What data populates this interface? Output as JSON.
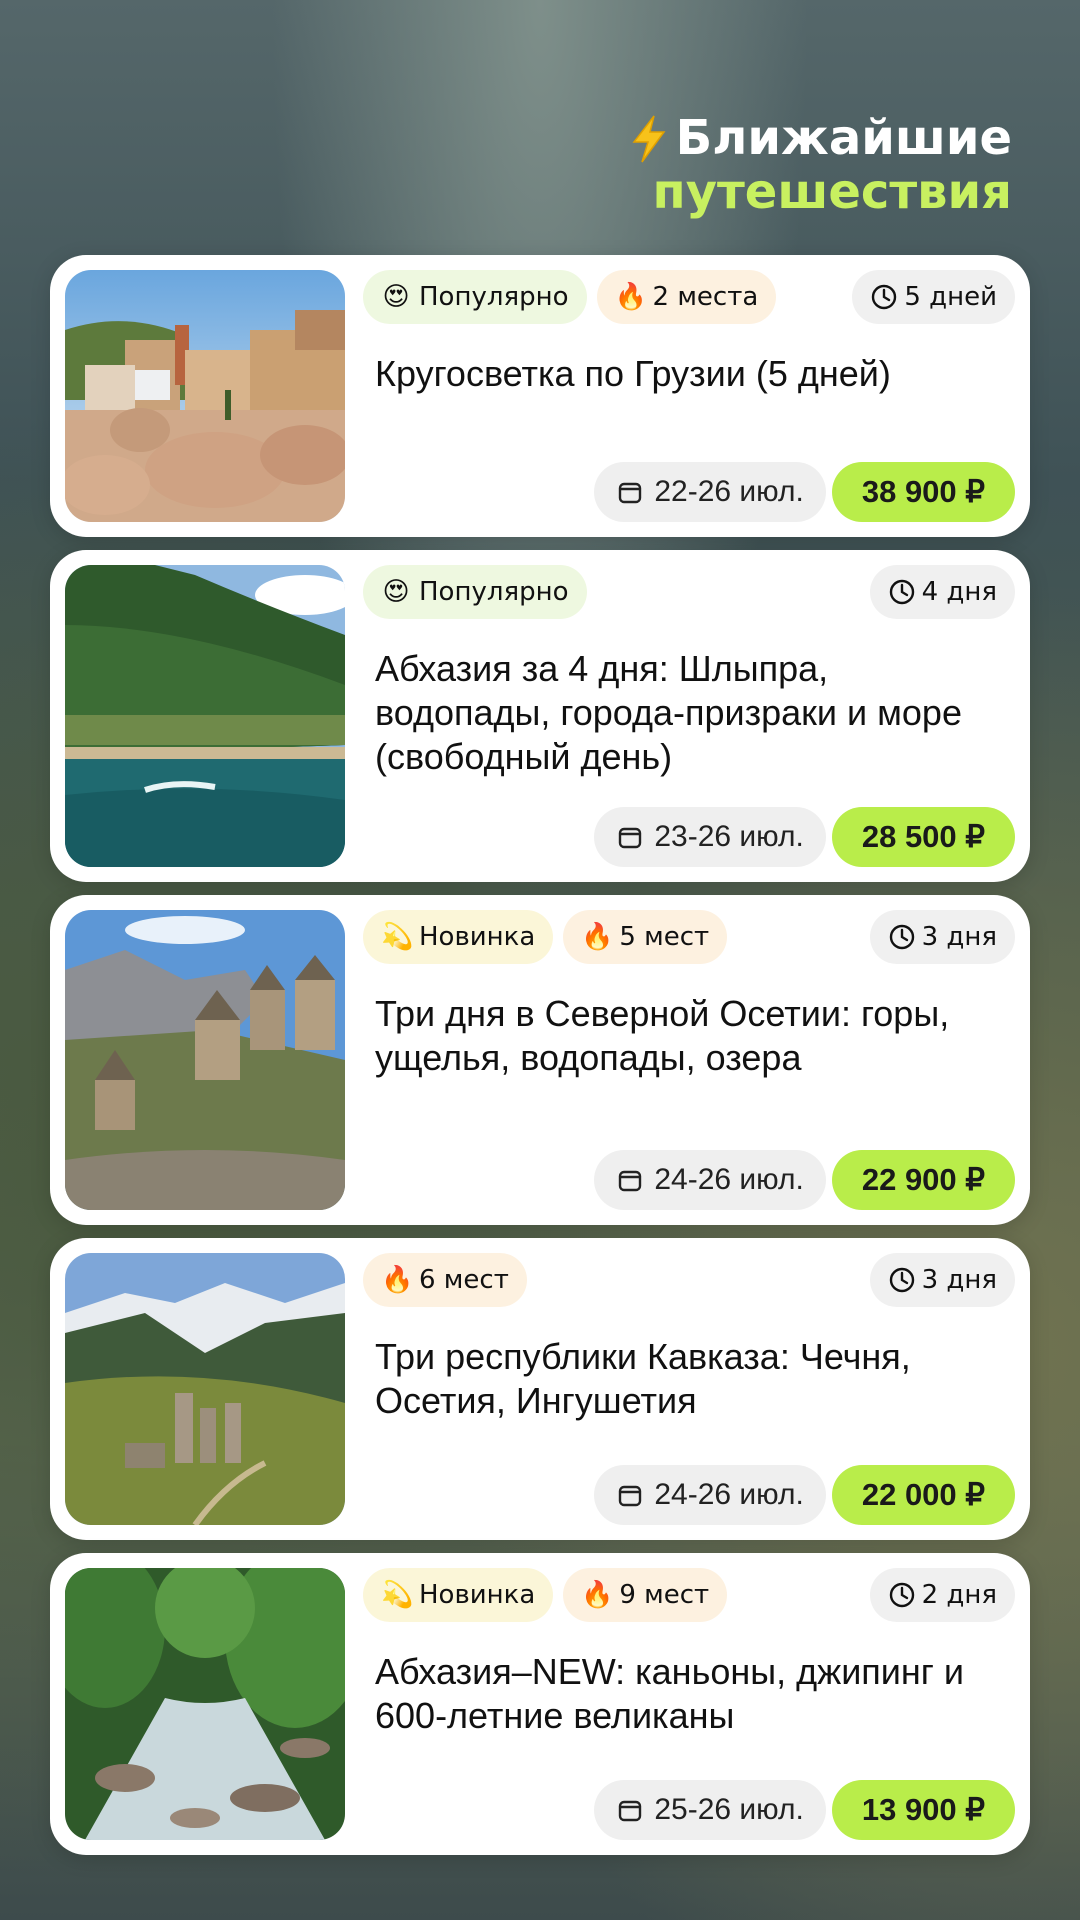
{
  "header": {
    "line1": "Ближайшие",
    "line2": "путешествия"
  },
  "tours": [
    {
      "tags": [
        {
          "kind": "popular",
          "emoji": "😍",
          "label": "Популярно"
        },
        {
          "kind": "spots",
          "emoji": "🔥",
          "label": "2 места"
        }
      ],
      "duration": "5 дней",
      "title": "Кругосветка по Грузии (5 дней)",
      "dates": "22-26 июл.",
      "price": "38 900 ₽",
      "image": "old-town-domes"
    },
    {
      "tags": [
        {
          "kind": "popular",
          "emoji": "😍",
          "label": "Популярно"
        }
      ],
      "duration": "4 дня",
      "title": "Абхазия за 4 дня: Шлыпра, водопады, города-призраки и море (свободный день)",
      "dates": "23-26 июл.",
      "price": "28 500 ₽",
      "image": "coast-and-sea"
    },
    {
      "tags": [
        {
          "kind": "new",
          "emoji": "💫",
          "label": "Новинка"
        },
        {
          "kind": "spots",
          "emoji": "🔥",
          "label": "5 мест"
        }
      ],
      "duration": "3 дня",
      "title": "Три дня в Северной Осетии: горы, ущелья, водопады, озера",
      "dates": "24-26 июл.",
      "price": "22 900 ₽",
      "image": "mountain-towers"
    },
    {
      "tags": [
        {
          "kind": "spots",
          "emoji": "🔥",
          "label": "6 мест"
        }
      ],
      "duration": "3 дня",
      "title": "Три республики Кавказа: Чечня, Осетия, Ингушетия",
      "dates": "24-26 июл.",
      "price": "22 000 ₽",
      "image": "valley-towers"
    },
    {
      "tags": [
        {
          "kind": "new",
          "emoji": "💫",
          "label": "Новинка"
        },
        {
          "kind": "spots",
          "emoji": "🔥",
          "label": "9 мест"
        }
      ],
      "duration": "2 дня",
      "title": "Абхазия–NEW: каньоны, джипинг и 600-летние великаны",
      "dates": "25-26 июл.",
      "price": "13 900 ₽",
      "image": "forest-river"
    }
  ]
}
